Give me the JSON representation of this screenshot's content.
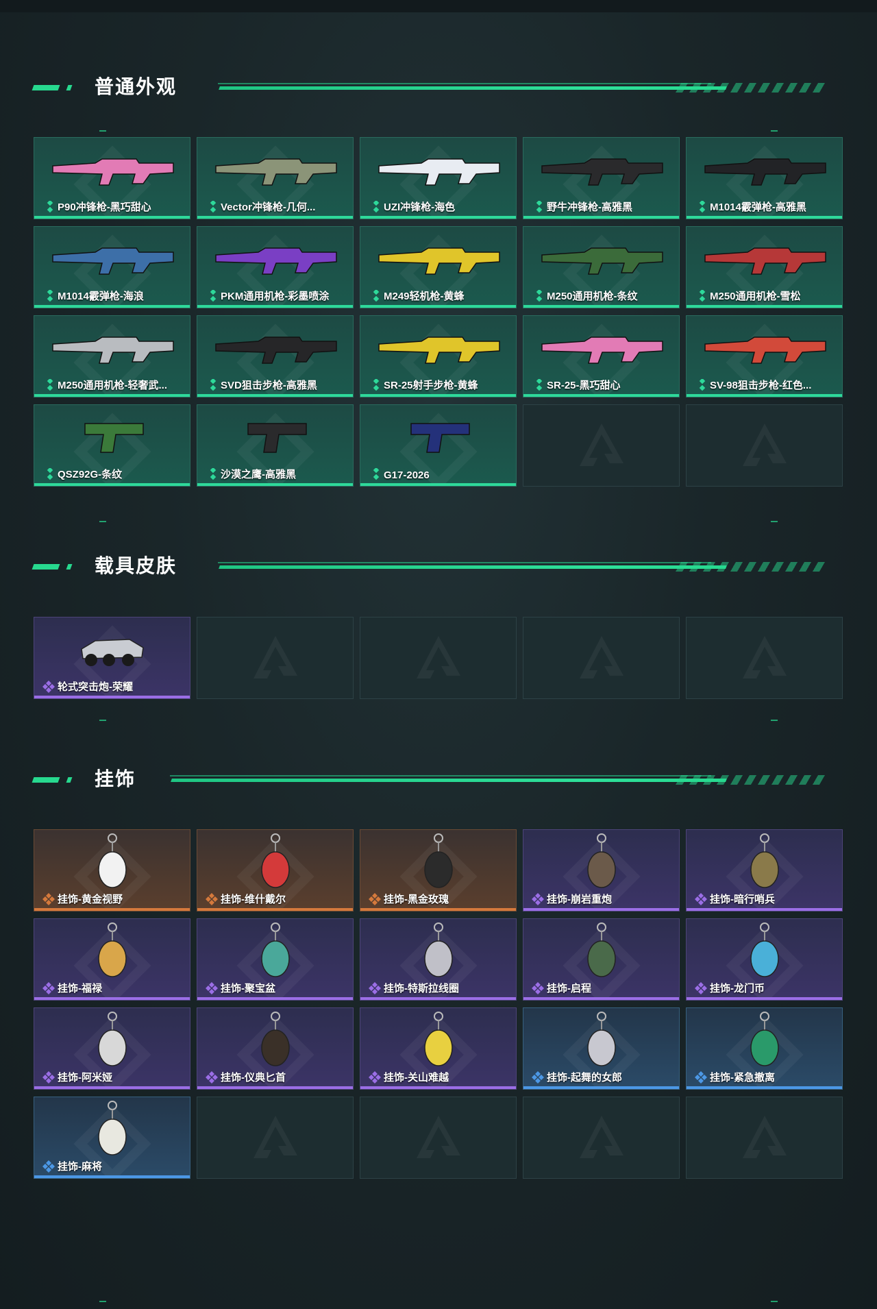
{
  "sections": {
    "weapons": {
      "title": "普通外观",
      "items": [
        {
          "label": "P90冲锋枪-黑巧甜心",
          "rarity": "green",
          "icon": "p90-smg-pink-skin-icon",
          "color": "#e27bb5"
        },
        {
          "label": "Vector冲锋枪-几何...",
          "rarity": "green",
          "icon": "vector-smg-camo-skin-icon",
          "color": "#8b9478"
        },
        {
          "label": "UZI冲锋枪-海色",
          "rarity": "green",
          "icon": "uzi-smg-blue-white-skin-icon",
          "color": "#e8ecf2"
        },
        {
          "label": "野牛冲锋枪-高雅黑",
          "rarity": "green",
          "icon": "bizon-smg-black-skin-icon",
          "color": "#2a2a2c"
        },
        {
          "label": "M1014霰弹枪-高雅黑",
          "rarity": "green",
          "icon": "m1014-shotgun-black-skin-icon",
          "color": "#222326"
        },
        {
          "label": "M1014霰弹枪-海浪",
          "rarity": "green",
          "icon": "m1014-shotgun-wave-skin-icon",
          "color": "#3d6fa8"
        },
        {
          "label": "PKM通用机枪-彩墨喷涂",
          "rarity": "green",
          "icon": "pkm-mg-graffiti-skin-icon",
          "color": "#7a3fc4"
        },
        {
          "label": "M249轻机枪-黄蜂",
          "rarity": "green",
          "icon": "m249-lmg-hornet-skin-icon",
          "color": "#e0c52a"
        },
        {
          "label": "M250通用机枪-条纹",
          "rarity": "green",
          "icon": "m250-mg-stripe-skin-icon",
          "color": "#3b6b3a"
        },
        {
          "label": "M250通用机枪-雪松",
          "rarity": "green",
          "icon": "m250-mg-cedar-skin-icon",
          "color": "#b63838"
        },
        {
          "label": "M250通用机枪-轻奢武...",
          "rarity": "green",
          "icon": "m250-mg-luxury-skin-icon",
          "color": "#b9bcc0"
        },
        {
          "label": "SVD狙击步枪-高雅黑",
          "rarity": "green",
          "icon": "svd-sniper-black-skin-icon",
          "color": "#262628"
        },
        {
          "label": "SR-25射手步枪-黄蜂",
          "rarity": "green",
          "icon": "sr25-rifle-hornet-skin-icon",
          "color": "#e0c52a"
        },
        {
          "label": "SR-25-黑巧甜心",
          "rarity": "green",
          "icon": "sr25-rifle-pink-skin-icon",
          "color": "#e27bb5"
        },
        {
          "label": "SV-98狙击步枪-红色...",
          "rarity": "green",
          "icon": "sv98-sniper-red-skin-icon",
          "color": "#d24a3a"
        },
        {
          "label": "QSZ92G-条纹",
          "rarity": "green",
          "icon": "qsz92g-pistol-stripe-skin-icon",
          "color": "#3b7a3a"
        },
        {
          "label": "沙漠之鹰-高雅黑",
          "rarity": "green",
          "icon": "desert-eagle-black-skin-icon",
          "color": "#2a2a2c"
        },
        {
          "label": "G17-2026",
          "rarity": "green",
          "icon": "g17-pistol-2026-skin-icon",
          "color": "#24317a"
        },
        {
          "label": "",
          "rarity": "empty",
          "icon": "empty-slot-logo-icon"
        },
        {
          "label": "",
          "rarity": "empty",
          "icon": "empty-slot-logo-icon"
        }
      ]
    },
    "vehicles": {
      "title": "载具皮肤",
      "items": [
        {
          "label": "轮式突击炮-荣耀",
          "rarity": "purple",
          "icon": "wheeled-assault-gun-glory-icon",
          "color": "#c9ccd2"
        },
        {
          "label": "",
          "rarity": "empty",
          "icon": "empty-slot-logo-icon"
        },
        {
          "label": "",
          "rarity": "empty",
          "icon": "empty-slot-logo-icon"
        },
        {
          "label": "",
          "rarity": "empty",
          "icon": "empty-slot-logo-icon"
        },
        {
          "label": "",
          "rarity": "empty",
          "icon": "empty-slot-logo-icon"
        }
      ]
    },
    "charms": {
      "title": "挂饰",
      "items": [
        {
          "label": "挂饰-黄金视野",
          "rarity": "orange",
          "icon": "charm-golden-vision-icon",
          "color": "#f2f2f2"
        },
        {
          "label": "挂饰-维什戴尔",
          "rarity": "orange",
          "icon": "charm-wisdel-icon",
          "color": "#d43a3a"
        },
        {
          "label": "挂饰-黑金玫瑰",
          "rarity": "orange",
          "icon": "charm-black-gold-rose-icon",
          "color": "#2b2b2b"
        },
        {
          "label": "挂饰-崩岩重炮",
          "rarity": "purple",
          "icon": "charm-rock-cannon-icon",
          "color": "#6b5a4a"
        },
        {
          "label": "挂饰-暗行哨兵",
          "rarity": "purple",
          "icon": "charm-shadow-sentinel-icon",
          "color": "#8a7a4a"
        },
        {
          "label": "挂饰-福禄",
          "rarity": "purple",
          "icon": "charm-fortune-icon",
          "color": "#d9a64a"
        },
        {
          "label": "挂饰-聚宝盆",
          "rarity": "purple",
          "icon": "charm-treasure-bowl-icon",
          "color": "#4aa89a"
        },
        {
          "label": "挂饰-特斯拉线圈",
          "rarity": "purple",
          "icon": "charm-tesla-coil-icon",
          "color": "#c0c0c8"
        },
        {
          "label": "挂饰-启程",
          "rarity": "purple",
          "icon": "charm-departure-icon",
          "color": "#4a6a4a"
        },
        {
          "label": "挂饰-龙门币",
          "rarity": "purple",
          "icon": "charm-lungmen-coin-icon",
          "color": "#4ab0d8"
        },
        {
          "label": "挂饰-阿米娅",
          "rarity": "purple",
          "icon": "charm-amiya-icon",
          "color": "#d8d8d8"
        },
        {
          "label": "挂饰-仪典匕首",
          "rarity": "purple",
          "icon": "charm-ceremonial-dagger-icon",
          "color": "#3a3028"
        },
        {
          "label": "挂饰-关山难越",
          "rarity": "purple",
          "icon": "charm-mountain-pass-icon",
          "color": "#e8d040"
        },
        {
          "label": "挂饰-起舞的女郎",
          "rarity": "blue",
          "icon": "charm-dancing-lady-icon",
          "color": "#c8c8d0"
        },
        {
          "label": "挂饰-紧急撤离",
          "rarity": "blue",
          "icon": "charm-emergency-evac-icon",
          "color": "#2a9a6a"
        },
        {
          "label": "挂饰-麻将",
          "rarity": "blue",
          "icon": "charm-mahjong-icon",
          "color": "#e8e8e0"
        },
        {
          "label": "",
          "rarity": "empty",
          "icon": "empty-slot-logo-icon"
        },
        {
          "label": "",
          "rarity": "empty",
          "icon": "empty-slot-logo-icon"
        },
        {
          "label": "",
          "rarity": "empty",
          "icon": "empty-slot-logo-icon"
        },
        {
          "label": "",
          "rarity": "empty",
          "icon": "empty-slot-logo-icon"
        }
      ]
    }
  },
  "colors": {
    "accent": "#27d98f",
    "rarity_green": "#2ed99a",
    "rarity_purple": "#9b6ee6",
    "rarity_orange": "#d5793c",
    "rarity_blue": "#4c98e6"
  }
}
